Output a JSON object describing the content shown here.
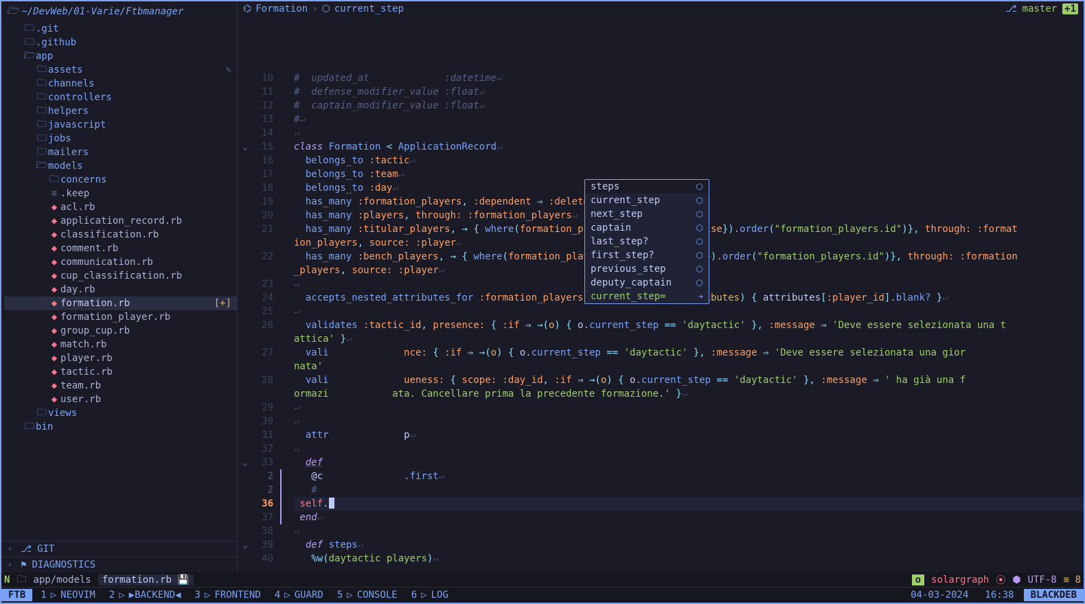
{
  "sidebar": {
    "cwd": "~/DevWeb/01-Varie/Ftbmanager",
    "tree": [
      {
        "type": "folder",
        "name": ".git",
        "indent": 1
      },
      {
        "type": "folder",
        "name": ".github",
        "indent": 1
      },
      {
        "type": "folder",
        "name": "app",
        "indent": 1,
        "open": true
      },
      {
        "type": "folder",
        "name": "assets",
        "indent": 2,
        "pencil": true
      },
      {
        "type": "folder",
        "name": "channels",
        "indent": 2
      },
      {
        "type": "folder",
        "name": "controllers",
        "indent": 2
      },
      {
        "type": "folder",
        "name": "helpers",
        "indent": 2
      },
      {
        "type": "folder",
        "name": "javascript",
        "indent": 2
      },
      {
        "type": "folder",
        "name": "jobs",
        "indent": 2
      },
      {
        "type": "folder",
        "name": "mailers",
        "indent": 2
      },
      {
        "type": "folder",
        "name": "models",
        "indent": 2,
        "open": true
      },
      {
        "type": "folder",
        "name": "concerns",
        "indent": 3
      },
      {
        "type": "keep",
        "name": ".keep",
        "indent": 3
      },
      {
        "type": "ruby",
        "name": "acl.rb",
        "indent": 3
      },
      {
        "type": "ruby",
        "name": "application_record.rb",
        "indent": 3
      },
      {
        "type": "ruby",
        "name": "classification.rb",
        "indent": 3
      },
      {
        "type": "ruby",
        "name": "comment.rb",
        "indent": 3
      },
      {
        "type": "ruby",
        "name": "communication.rb",
        "indent": 3
      },
      {
        "type": "ruby",
        "name": "cup_classification.rb",
        "indent": 3
      },
      {
        "type": "ruby",
        "name": "day.rb",
        "indent": 3
      },
      {
        "type": "ruby",
        "name": "formation.rb",
        "indent": 3,
        "selected": true,
        "badge": "[+]"
      },
      {
        "type": "ruby",
        "name": "formation_player.rb",
        "indent": 3
      },
      {
        "type": "ruby",
        "name": "group_cup.rb",
        "indent": 3
      },
      {
        "type": "ruby",
        "name": "match.rb",
        "indent": 3
      },
      {
        "type": "ruby",
        "name": "player.rb",
        "indent": 3
      },
      {
        "type": "ruby",
        "name": "tactic.rb",
        "indent": 3
      },
      {
        "type": "ruby",
        "name": "team.rb",
        "indent": 3
      },
      {
        "type": "ruby",
        "name": "user.rb",
        "indent": 3
      },
      {
        "type": "folder",
        "name": "views",
        "indent": 2
      },
      {
        "type": "folder",
        "name": "bin",
        "indent": 1
      }
    ],
    "git_section": "GIT",
    "diag_section": "DIAGNOSTICS"
  },
  "breadcrumb": {
    "class_label": "Formation",
    "member_label": "current_step",
    "branch": "master",
    "plus": "1"
  },
  "code": {
    "lines": [
      {
        "n": "10",
        "html": "<span class='cmt'>#  updated_at             :datetime</span><span class='nl'>↵</span>"
      },
      {
        "n": "11",
        "html": "<span class='cmt'>#  defense_modifier_value :float</span><span class='nl'>↵</span>"
      },
      {
        "n": "12",
        "html": "<span class='cmt'>#  captain_modifier_value :float</span><span class='nl'>↵</span>"
      },
      {
        "n": "13",
        "html": "<span class='cmt'>#</span><span class='nl'>↵</span>"
      },
      {
        "n": "14",
        "html": "<span class='nl'>↵</span>"
      },
      {
        "n": "15",
        "fold": "⌄",
        "html": "<span class='kw'>class</span> <span class='cls'>Formation</span> <span class='op'>&lt;</span> <span class='cls'>ApplicationRecord</span><span class='nl'>↵</span>"
      },
      {
        "n": "16",
        "html": "  <span class='fn'>belongs_to</span> <span class='sym'>:tactic</span><span class='nl'>↵</span>"
      },
      {
        "n": "17",
        "html": "  <span class='fn'>belongs_to</span> <span class='sym'>:team</span><span class='nl'>↵</span>"
      },
      {
        "n": "18",
        "html": "  <span class='fn'>belongs_to</span> <span class='sym'>:day</span><span class='nl'>↵</span>"
      },
      {
        "n": "19",
        "html": "  <span class='fn'>has_many</span> <span class='sym'>:formation_players</span><span class='op'>,</span> <span class='sym'>:dependent</span> <span class='op'>⇒</span> <span class='sym'>:delete_all</span><span class='nl'>↵</span>"
      },
      {
        "n": "20",
        "html": "  <span class='fn'>has_many</span> <span class='sym'>:players</span><span class='op'>,</span> <span class='sym'>through:</span> <span class='sym'>:formation_players</span><span class='nl'>↵</span>"
      },
      {
        "n": "21",
        "html": "  <span class='fn'>has_many</span> <span class='sym'>:titular_players</span><span class='op'>,</span> <span class='op'>→</span> <span class='op'>{</span> <span class='fn'>where</span><span class='op'>(</span><span class='sym'>formation_players:</span> <span class='op'>{</span><span class='sym'>is_bench:</span> <span class='bool'>false</span><span class='op'>})</span>.<span class='fn'>order</span><span class='op'>(</span><span class='str'>\"formation_players.id\"</span><span class='op'>)}</span><span class='op'>,</span> <span class='sym'>through:</span> <span class='sym'>:format</span>"
      },
      {
        "n": "",
        "html": "<span class='sym'>ion_players</span><span class='op'>,</span> <span class='sym'>source:</span> <span class='sym'>:player</span><span class='nl'>↵</span>"
      },
      {
        "n": "22",
        "html": "  <span class='fn'>has_many</span> <span class='sym'>:bench_players</span><span class='op'>,</span> <span class='op'>→</span> <span class='op'>{</span> <span class='fn'>where</span><span class='op'>(</span><span class='sym'>formation_players:</span> <span class='op'>{</span><span class='sym'>is_bench:</span> <span class='bool'>true</span><span class='op'>})</span>.<span class='fn'>order</span><span class='op'>(</span><span class='str'>\"formation_players.id\"</span><span class='op'>)}</span><span class='op'>,</span> <span class='sym'>through:</span> <span class='sym'>:formation</span>"
      },
      {
        "n": "",
        "html": "<span class='sym'>_players</span><span class='op'>,</span> <span class='sym'>source:</span> <span class='sym'>:player</span><span class='nl'>↵</span>"
      },
      {
        "n": "23",
        "html": "<span class='nl'>↵</span>"
      },
      {
        "n": "24",
        "html": "  <span class='fn'>accepts_nested_attributes_for</span> <span class='sym'>:formation_players</span><span class='op'>,</span> <span class='sym'>:reject_if</span> <span class='op'>⇒</span> <span class='op'>→(</span><span class='prm'>attributes</span><span class='op'>)</span> <span class='op'>{</span> <span class='var'>attributes</span><span class='op'>[</span><span class='sym'>:player_id</span><span class='op'>]</span>.<span class='fn'>blank?</span> <span class='op'>}</span><span class='nl'>↵</span>"
      },
      {
        "n": "25",
        "html": "<span class='nl'>↵</span>"
      },
      {
        "n": "26",
        "html": "  <span class='fn'>validates</span> <span class='sym'>:tactic_id</span><span class='op'>,</span> <span class='sym'>presence:</span> <span class='op'>{</span> <span class='sym'>:if</span> <span class='op'>⇒</span> <span class='op'>→(</span><span class='prm'>o</span><span class='op'>)</span> <span class='op'>{</span> <span class='var'>o</span>.<span class='fn'>current_step</span> <span class='op'>==</span> <span class='str'>'daytactic'</span> <span class='op'>}</span><span class='op'>,</span> <span class='sym'>:message</span> <span class='op'>⇒</span> <span class='str'>'Deve essere selezionata una t</span>"
      },
      {
        "n": "",
        "html": "<span class='str'>attica'</span> <span class='op'>}</span><span class='nl'>↵</span>"
      },
      {
        "n": "27",
        "html": "  <span class='fn'>vali</span>             <span class='sym'>nce:</span> <span class='op'>{</span> <span class='sym'>:if</span> <span class='op'>⇒</span> <span class='op'>→(</span><span class='prm'>o</span><span class='op'>)</span> <span class='op'>{</span> <span class='var'>o</span>.<span class='fn'>current_step</span> <span class='op'>==</span> <span class='str'>'daytactic'</span> <span class='op'>}</span><span class='op'>,</span> <span class='sym'>:message</span> <span class='op'>⇒</span> <span class='str'>'Deve essere selezionata una gior</span>"
      },
      {
        "n": "",
        "html": "<span class='str'>nata'</span>"
      },
      {
        "n": "28",
        "html": "  <span class='fn'>vali</span>             <span class='sym'>ueness:</span> <span class='op'>{</span> <span class='sym'>scope:</span> <span class='sym'>:day_id</span><span class='op'>,</span> <span class='sym'>:if</span> <span class='op'>⇒</span> <span class='op'>→(</span><span class='prm'>o</span><span class='op'>)</span> <span class='op'>{</span> <span class='var'>o</span>.<span class='fn'>current_step</span> <span class='op'>==</span> <span class='str'>'daytactic'</span> <span class='op'>}</span><span class='op'>,</span> <span class='sym'>:message</span> <span class='op'>⇒</span> <span class='str'>' ha già una f</span>"
      },
      {
        "n": "",
        "html": "<span class='str'>ormazi</span>           <span class='str'>ata. Cancellare prima la precedente formazione.'</span> <span class='op'>}</span><span class='nl'>↵</span>"
      },
      {
        "n": "29",
        "html": "<span class='nl'>↵</span>"
      },
      {
        "n": "30",
        "html": "<span class='nl'>↵</span>"
      },
      {
        "n": "31",
        "html": "  <span class='fn'>attr</span>             <span class='var'>p</span><span class='nl'>↵</span>"
      },
      {
        "n": "32",
        "html": "<span class='nl'>↵</span>"
      },
      {
        "n": "33",
        "fold": "⌄",
        "html": "  <span class='kw ul'>def</span> "
      },
      {
        "n": "2",
        "rel": true,
        "sign": true,
        "html": "   <span class='var'>@c</span>              .<span class='fn'>first</span><span class='nl'>↵</span>"
      },
      {
        "n": "2",
        "rel": true,
        "sign": true,
        "html": "   <span class='cmt'>#</span>"
      },
      {
        "n": "36",
        "curr": true,
        "sign": true,
        "cursorline": true,
        "html": " <span class='self'>self</span><span class='op'>.</span><span class='cursor-block'></span>"
      },
      {
        "n": "37",
        "sign": true,
        "html": " <span class='kw'>end</span><span class='nl'>↵</span>"
      },
      {
        "n": "38",
        "html": "<span class='nl'>↵</span>"
      },
      {
        "n": "39",
        "fold": "⌄",
        "html": "  <span class='kw'>def</span> <span class='fn'>steps</span><span class='nl'>↵</span>"
      },
      {
        "n": "40",
        "html": "   <span class='op'>%w(</span><span class='str'>daytactic players</span><span class='op'>)</span><span class='nl'>↵</span>"
      }
    ]
  },
  "popup": {
    "items": [
      {
        "label": "steps",
        "kind": "⬡"
      },
      {
        "label": "current_step",
        "kind": "⬡"
      },
      {
        "label": "next_step",
        "kind": "⬡"
      },
      {
        "label": "captain",
        "kind": "⬡"
      },
      {
        "label": "last_step?",
        "kind": "⬡"
      },
      {
        "label": "first_step?",
        "kind": "⬡"
      },
      {
        "label": "previous_step",
        "kind": "⬡"
      },
      {
        "label": "deputy_captain",
        "kind": "⬡"
      },
      {
        "label": "current_step=",
        "kind": "➔",
        "cseq": true
      }
    ]
  },
  "bufline": {
    "nvim_icon": "N",
    "folder_icon": "📁",
    "path": "app/models",
    "filename": "formation.rb",
    "modified_icon": "💾",
    "mode": "o",
    "lsp": "solargraph",
    "encoding": "UTF-8",
    "lines_icon": "≡",
    "lines_count": "8"
  },
  "tmux": {
    "session": "FTB",
    "windows": [
      {
        "idx": "1",
        "name": "NEOVIM",
        "active": true
      },
      {
        "idx": "2",
        "name": "BACKEND",
        "boxed": true
      },
      {
        "idx": "3",
        "name": "FRONTEND"
      },
      {
        "idx": "4",
        "name": "GUARD"
      },
      {
        "idx": "5",
        "name": "CONSOLE"
      },
      {
        "idx": "6",
        "name": "LOG"
      }
    ],
    "date": "04-03-2024",
    "time": "16:38",
    "host": "BLACKDEB"
  }
}
